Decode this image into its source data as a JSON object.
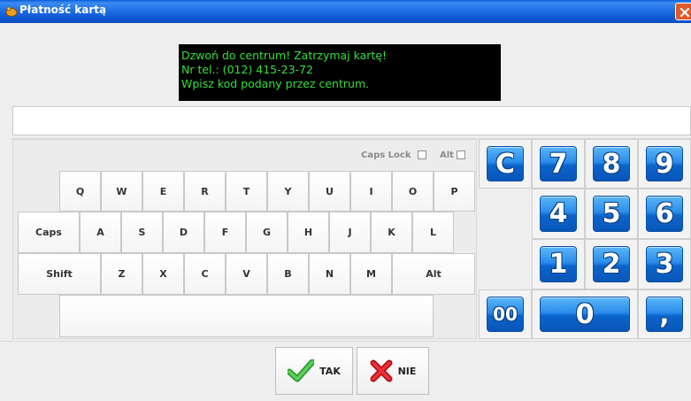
{
  "window": {
    "title": "Płatność kartą"
  },
  "message": {
    "lines": [
      "Dzwoń do centrum!  Zatrzymaj kartę!",
      "Nr tel.: (012) 415-23-72",
      "Wpisz kod podany przez centrum."
    ],
    "text_color": "#34e03a",
    "background": "#000000"
  },
  "code_input": {
    "value": ""
  },
  "options": {
    "caps_lock_label": "Caps Lock",
    "caps_lock_checked": false,
    "alt_label": "Alt",
    "alt_checked": false
  },
  "keyboard": {
    "row1": [
      "Q",
      "W",
      "E",
      "R",
      "T",
      "Y",
      "U",
      "I",
      "O",
      "P"
    ],
    "row2": [
      "Caps",
      "A",
      "S",
      "D",
      "F",
      "G",
      "H",
      "J",
      "K",
      "L"
    ],
    "row3": [
      "Shift",
      "Z",
      "X",
      "C",
      "V",
      "B",
      "N",
      "M",
      "Alt"
    ],
    "space": ""
  },
  "numpad": {
    "row1": [
      "C",
      "7",
      "8",
      "9"
    ],
    "row2": [
      "4",
      "5",
      "6"
    ],
    "row3": [
      "1",
      "2",
      "3"
    ],
    "row4": [
      "00",
      "0",
      ","
    ]
  },
  "actions": {
    "ok_label": "TAK",
    "cancel_label": "NIE"
  },
  "icons": {
    "ok": "green-check-icon",
    "cancel": "red-x-icon",
    "close": "close-icon",
    "app": "app-icon"
  },
  "colors": {
    "titlebar": "#0a5fd8",
    "numpad_key": "#2a8cea",
    "ok_icon": "#3cb43c",
    "cancel_icon": "#e0202a"
  }
}
